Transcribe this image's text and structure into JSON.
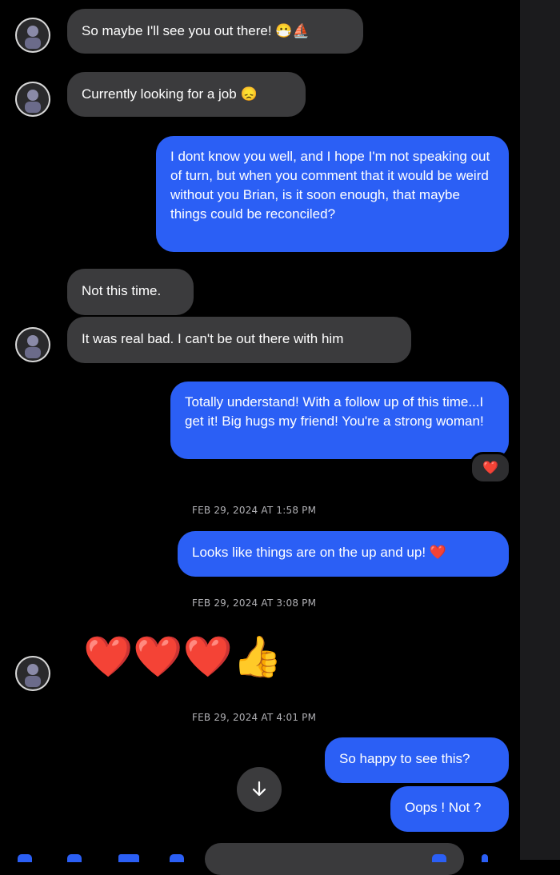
{
  "messages": {
    "m1": "So maybe I'll see you out there!",
    "m2": "Currently looking for a job",
    "m3": "I dont know you well, and I hope I'm not speaking out of turn, but when you comment that it would be weird without you Brian, is it soon enough, that maybe things could be reconciled?",
    "m4": "Not this time.",
    "m5": "It was real bad. I can't be out there with him",
    "m6": "Totally understand! With a follow up of this time...I get it! Big hugs my friend! You're a strong woman!",
    "m7": "Looks like things are on the up and up!",
    "m9": "So happy to see this?",
    "m10": "Oops ! Not ?"
  },
  "timestamps": {
    "t1": "FEB 29, 2024 AT 1:58 PM",
    "t2": "FEB 29, 2024 AT 3:08 PM",
    "t3": "FEB 29, 2024 AT 4:01 PM"
  },
  "icons": {
    "m1_emoji": "😷⛵",
    "m2_emoji": "😞",
    "m7_emoji": "❤️",
    "reaction": "❤️",
    "big_emojis": "❤️❤️❤️👍",
    "scroll": "arrow-down-icon"
  },
  "colors": {
    "background": "#000000",
    "incoming_bubble": "#3b3b3d",
    "outgoing_bubble": "#2b5ff5"
  }
}
